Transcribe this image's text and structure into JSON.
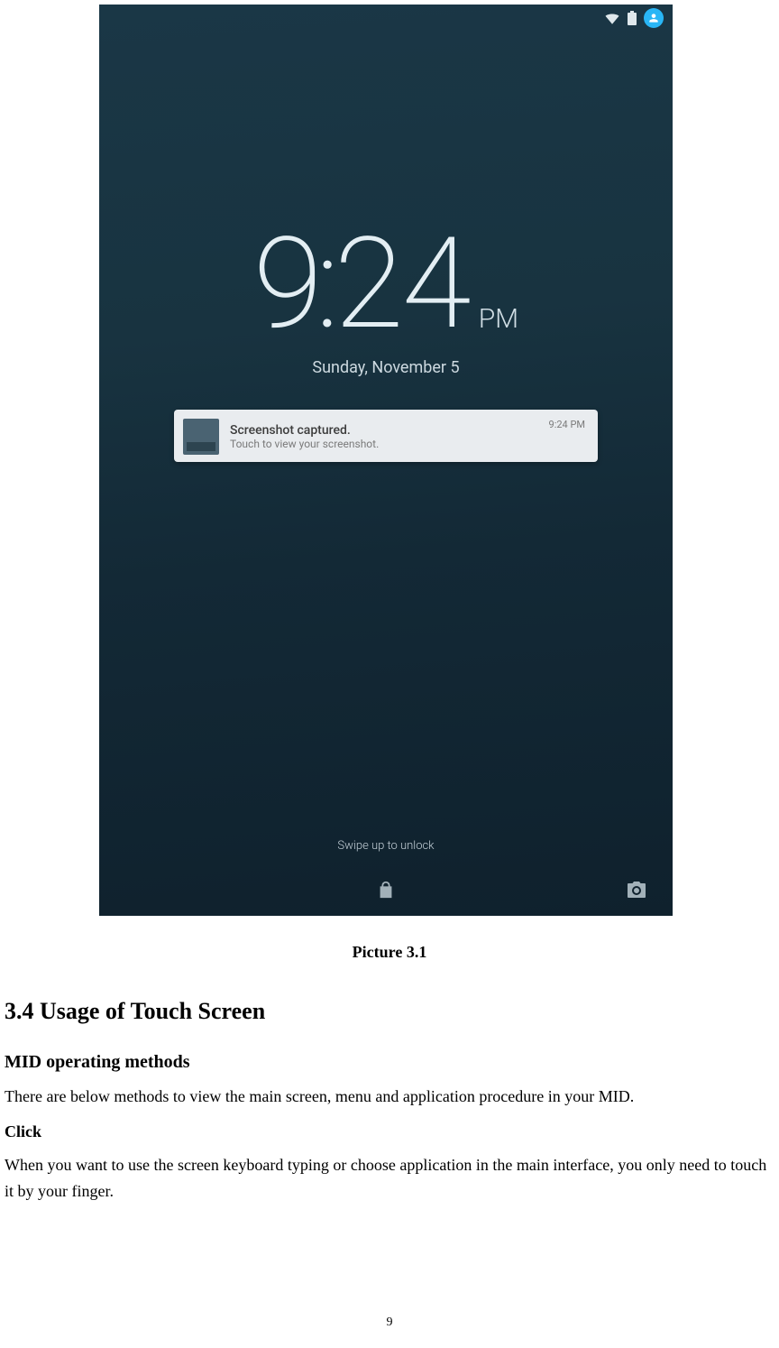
{
  "phone": {
    "clock": {
      "hour": "9",
      "minute": "24",
      "ampm": "PM"
    },
    "date": "Sunday, November 5",
    "notification": {
      "title": "Screenshot captured.",
      "subtitle": "Touch to view your screenshot.",
      "time": "9:24 PM"
    },
    "swipe_hint": "Swipe up to unlock"
  },
  "doc": {
    "caption": "Picture 3.1",
    "heading_34": "3.4 Usage of Touch Screen",
    "heading_methods": "MID operating methods",
    "p_methods": "There are below methods to view the main screen, menu and application procedure in your MID.",
    "heading_click": "Click",
    "p_click": "When you want to use the screen keyboard typing or choose application in the main interface, you only need to touch it by your finger.",
    "page_number": "9"
  }
}
